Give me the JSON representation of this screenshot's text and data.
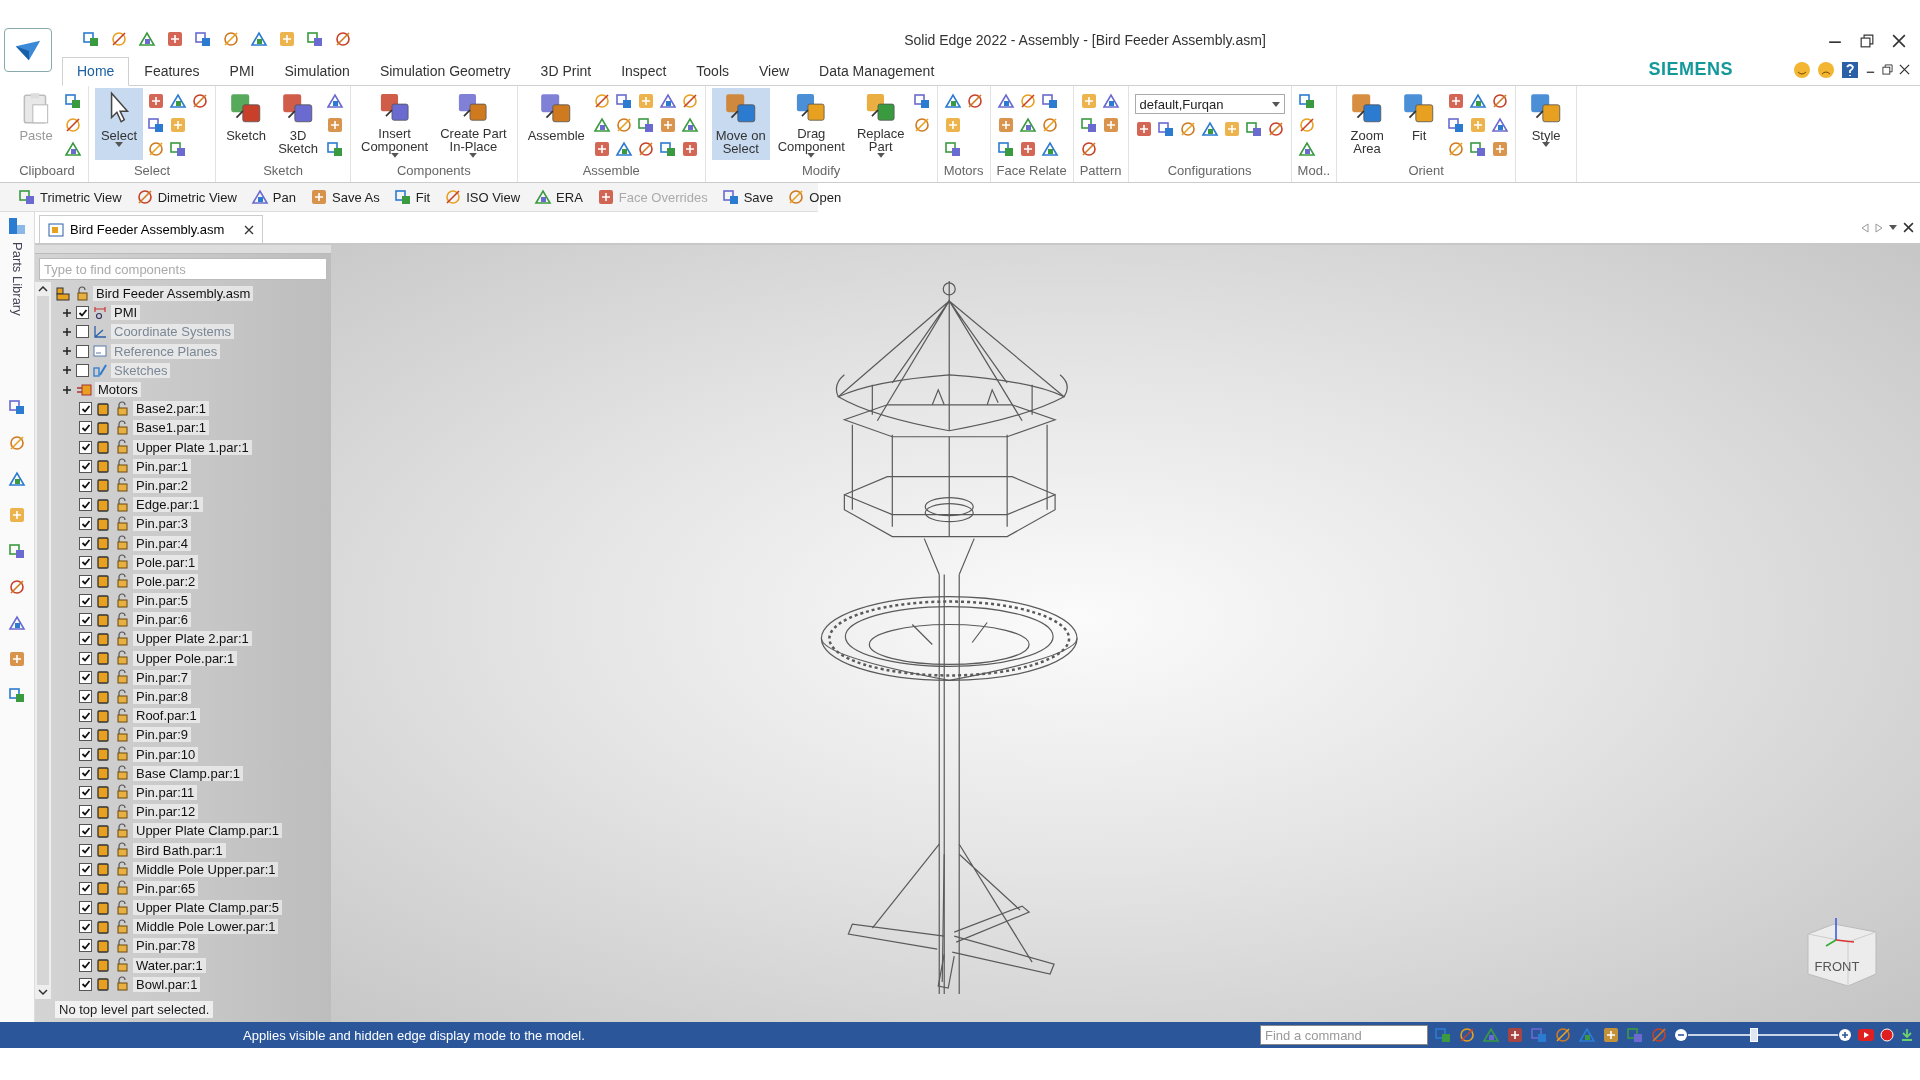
{
  "window": {
    "title": "Solid Edge 2022 - Assembly - [Bird Feeder Assembly.asm]"
  },
  "ribbon_tabs": [
    {
      "label": "Home",
      "selected": true
    },
    {
      "label": "Features",
      "selected": false
    },
    {
      "label": "PMI",
      "selected": false
    },
    {
      "label": "Simulation",
      "selected": false
    },
    {
      "label": "Simulation Geometry",
      "selected": false
    },
    {
      "label": "3D Print",
      "selected": false
    },
    {
      "label": "Inspect",
      "selected": false
    },
    {
      "label": "Tools",
      "selected": false
    },
    {
      "label": "View",
      "selected": false
    },
    {
      "label": "Data Management",
      "selected": false
    }
  ],
  "brand": "SIEMENS",
  "ribbon_groups": [
    {
      "label": "Clipboard",
      "buttons": [
        {
          "label": "Paste",
          "selected": false,
          "disabled": true,
          "dropdown": false
        }
      ]
    },
    {
      "label": "Select",
      "buttons": [
        {
          "label": "Select",
          "selected": true,
          "disabled": false,
          "dropdown": true
        }
      ]
    },
    {
      "label": "Sketch",
      "buttons": [
        {
          "label": "Sketch",
          "selected": false,
          "disabled": false,
          "dropdown": false
        },
        {
          "label": "3D\nSketch",
          "selected": false,
          "disabled": false,
          "dropdown": false
        }
      ]
    },
    {
      "label": "Components",
      "buttons": [
        {
          "label": "Insert\nComponent",
          "selected": false,
          "disabled": false,
          "dropdown": true
        },
        {
          "label": "Create Part\nIn-Place",
          "selected": false,
          "disabled": false,
          "dropdown": true
        }
      ]
    },
    {
      "label": "Assemble",
      "buttons": [
        {
          "label": "Assemble",
          "selected": false,
          "disabled": false,
          "dropdown": false
        }
      ]
    },
    {
      "label": "Modify",
      "buttons": [
        {
          "label": "Move on\nSelect",
          "selected": true,
          "disabled": false,
          "dropdown": false
        },
        {
          "label": "Drag\nComponent",
          "selected": false,
          "disabled": false,
          "dropdown": true
        },
        {
          "label": "Replace\nPart",
          "selected": false,
          "disabled": false,
          "dropdown": true
        }
      ]
    },
    {
      "label": "Motors"
    },
    {
      "label": "Face Relate"
    },
    {
      "label": "Pattern"
    },
    {
      "label": "Configurations",
      "combo": {
        "value": "default,Furqan"
      }
    },
    {
      "label": "Mod.."
    },
    {
      "label": "Orient",
      "buttons": [
        {
          "label": "Zoom\nArea",
          "selected": false,
          "disabled": false,
          "dropdown": false
        },
        {
          "label": "Fit",
          "selected": false,
          "disabled": false,
          "dropdown": false
        }
      ]
    },
    {
      "buttons": [
        {
          "label": "Style",
          "selected": false,
          "disabled": false,
          "dropdown": true
        }
      ]
    }
  ],
  "quick_toolbar": [
    {
      "label": "Trimetric View",
      "disabled": false
    },
    {
      "label": "Dimetric View",
      "disabled": false
    },
    {
      "label": "Pan",
      "disabled": false
    },
    {
      "label": "Save As",
      "disabled": false
    },
    {
      "label": "Fit",
      "disabled": false
    },
    {
      "label": "ISO View",
      "disabled": false
    },
    {
      "label": "ERA",
      "disabled": false
    },
    {
      "label": "Face Overrides",
      "disabled": true
    },
    {
      "label": "Save",
      "disabled": false
    },
    {
      "label": "Open",
      "disabled": false
    }
  ],
  "document_tab": {
    "label": "Bird Feeder Assembly.asm"
  },
  "side_strip": {
    "label": "Parts Library"
  },
  "pathfinder": {
    "search": {
      "placeholder": "Type to find components"
    },
    "root": {
      "label": "Bird Feeder Assembly.asm",
      "children": [
        {
          "label": "PMI",
          "kind": "pmi",
          "expanded": false,
          "checked": true
        },
        {
          "label": "Coordinate Systems",
          "kind": "coords",
          "expanded": false,
          "checked": false
        },
        {
          "label": "Reference Planes",
          "kind": "planes",
          "expanded": false,
          "checked": false
        },
        {
          "label": "Sketches",
          "kind": "sketches",
          "expanded": false,
          "checked": false
        },
        {
          "label": "Motors",
          "kind": "motors",
          "expanded": false
        },
        {
          "label": "Base2.par:1",
          "kind": "part",
          "checked": true
        },
        {
          "label": "Base1.par:1",
          "kind": "part",
          "checked": true
        },
        {
          "label": "Upper Plate 1.par:1",
          "kind": "part",
          "checked": true
        },
        {
          "label": "Pin.par:1",
          "kind": "part",
          "checked": true
        },
        {
          "label": "Pin.par:2",
          "kind": "part",
          "checked": true
        },
        {
          "label": "Edge.par:1",
          "kind": "part",
          "checked": true
        },
        {
          "label": "Pin.par:3",
          "kind": "part",
          "checked": true
        },
        {
          "label": "Pin.par:4",
          "kind": "part",
          "checked": true
        },
        {
          "label": "Pole.par:1",
          "kind": "part",
          "checked": true
        },
        {
          "label": "Pole.par:2",
          "kind": "part",
          "checked": true
        },
        {
          "label": "Pin.par:5",
          "kind": "part",
          "checked": true
        },
        {
          "label": "Pin.par:6",
          "kind": "part",
          "checked": true
        },
        {
          "label": "Upper Plate 2.par:1",
          "kind": "part",
          "checked": true
        },
        {
          "label": "Upper Pole.par:1",
          "kind": "part",
          "checked": true
        },
        {
          "label": "Pin.par:7",
          "kind": "part",
          "checked": true
        },
        {
          "label": "Pin.par:8",
          "kind": "part",
          "checked": true
        },
        {
          "label": "Roof.par:1",
          "kind": "part",
          "checked": true
        },
        {
          "label": "Pin.par:9",
          "kind": "part",
          "checked": true
        },
        {
          "label": "Pin.par:10",
          "kind": "part",
          "checked": true
        },
        {
          "label": "Base Clamp.par:1",
          "kind": "part",
          "checked": true
        },
        {
          "label": "Pin.par:11",
          "kind": "part",
          "checked": true
        },
        {
          "label": "Pin.par:12",
          "kind": "part",
          "checked": true
        },
        {
          "label": "Upper Plate Clamp.par:1",
          "kind": "part",
          "checked": true
        },
        {
          "label": "Bird Bath.par:1",
          "kind": "part",
          "checked": true
        },
        {
          "label": "Middle Pole Upper.par:1",
          "kind": "part",
          "checked": true
        },
        {
          "label": "Pin.par:65",
          "kind": "part",
          "checked": true
        },
        {
          "label": "Upper Plate Clamp.par:5",
          "kind": "part",
          "checked": true
        },
        {
          "label": "Middle Pole Lower.par:1",
          "kind": "part",
          "checked": true
        },
        {
          "label": "Pin.par:78",
          "kind": "part",
          "checked": true
        },
        {
          "label": "Water.par:1",
          "kind": "part",
          "checked": true
        },
        {
          "label": "Bowl.par:1",
          "kind": "part",
          "checked": true
        }
      ]
    },
    "status": "No top level part selected."
  },
  "view_cube": {
    "label": "FRONT"
  },
  "status_bar": {
    "message": "Applies visible and hidden edge display mode to the model.",
    "command_search": {
      "placeholder": "Find a command"
    },
    "zoom_slider": {
      "level": 0.44
    }
  }
}
